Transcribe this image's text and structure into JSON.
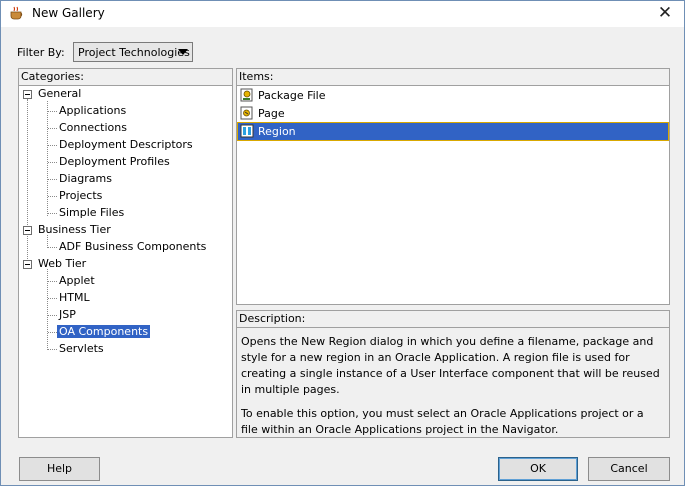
{
  "window": {
    "title": "New Gallery",
    "close_glyph": "✕"
  },
  "filter": {
    "label": "Filter By:",
    "selected": "Project Technologies"
  },
  "categories": {
    "header": "Categories:",
    "nodes": [
      {
        "label": "General",
        "level": 0,
        "expanded": true
      },
      {
        "label": "Applications",
        "level": 1
      },
      {
        "label": "Connections",
        "level": 1
      },
      {
        "label": "Deployment Descriptors",
        "level": 1
      },
      {
        "label": "Deployment Profiles",
        "level": 1
      },
      {
        "label": "Diagrams",
        "level": 1
      },
      {
        "label": "Projects",
        "level": 1
      },
      {
        "label": "Simple Files",
        "level": 1
      },
      {
        "label": "Business Tier",
        "level": 0,
        "expanded": true
      },
      {
        "label": "ADF Business Components",
        "level": 1
      },
      {
        "label": "Web Tier",
        "level": 0,
        "expanded": true
      },
      {
        "label": "Applet",
        "level": 1
      },
      {
        "label": "HTML",
        "level": 1
      },
      {
        "label": "JSP",
        "level": 1
      },
      {
        "label": "OA Components",
        "level": 1,
        "selected": true
      },
      {
        "label": "Servlets",
        "level": 1
      }
    ]
  },
  "items": {
    "header": "Items:",
    "list": [
      {
        "label": "Package File",
        "icon": "package-file-icon"
      },
      {
        "label": "Page",
        "icon": "page-icon"
      },
      {
        "label": "Region",
        "icon": "region-icon",
        "selected": true
      }
    ]
  },
  "description": {
    "header": "Description:",
    "para1": "Opens the New Region dialog in which you define a filename, package and style for a new region in an Oracle Application. A region file is used for creating a single instance of a User Interface component that will be reused in multiple pages.",
    "para2": "To enable this option, you must select an Oracle Applications project or a file within an Oracle Applications project in the Navigator."
  },
  "buttons": {
    "help": "Help",
    "ok": "OK",
    "cancel": "Cancel"
  },
  "colors": {
    "selection": "#3163c5",
    "dialog_bg": "#f0f0f0"
  }
}
